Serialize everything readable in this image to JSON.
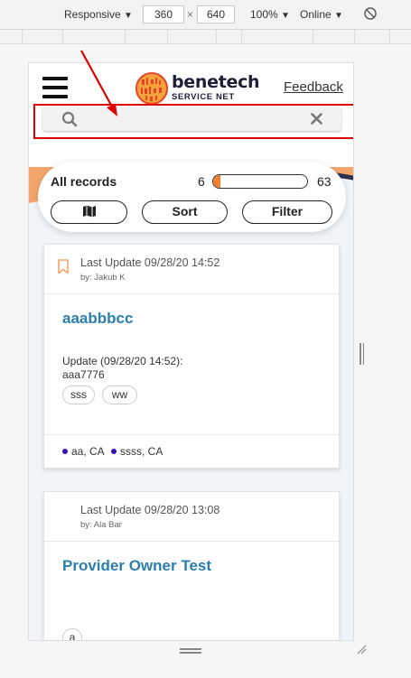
{
  "devtools": {
    "device": "Responsive",
    "width": "360",
    "times": "×",
    "height": "640",
    "zoom": "100%",
    "network": "Online",
    "dropdown_glyph": "▼"
  },
  "header": {
    "logo_text": "benetech",
    "logo_subtext": "SERVICE NET",
    "feedback_label": "Feedback"
  },
  "search": {
    "value": "",
    "placeholder": ""
  },
  "records": {
    "title": "All records",
    "min": "6",
    "max": "63",
    "progress": 0.08,
    "map_icon": "map-icon",
    "sort_label": "Sort",
    "filter_label": "Filter"
  },
  "cards": [
    {
      "last_update": "Last Update 09/28/20 14:52",
      "by": "by: Jakub K",
      "title": "aaabbbcc",
      "update_line1": "Update (09/28/20 14:52):",
      "update_line2": "aaa7776",
      "tags": [
        "sss",
        "ww"
      ],
      "locations": [
        "aa, CA",
        "ssss, CA"
      ],
      "bookmark": true
    },
    {
      "last_update": "Last Update 09/28/20 13:08",
      "by": "by: Ala Bar",
      "title": "Provider Owner Test",
      "tags": [
        "a"
      ],
      "bookmark": false
    }
  ],
  "colors": {
    "accent_orange": "#f07f2e",
    "title_blue": "#2a7fae",
    "location_dot": "#3412b8",
    "highlight_red": "#e00000"
  }
}
